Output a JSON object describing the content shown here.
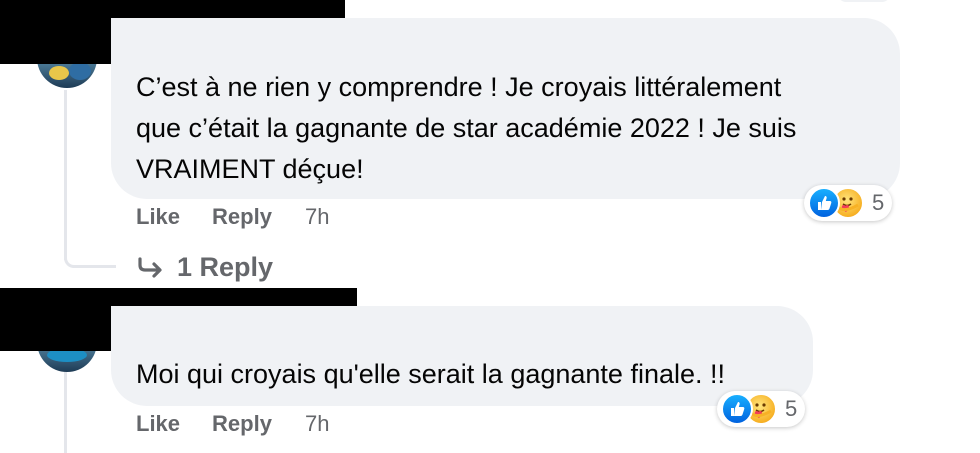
{
  "comments": [
    {
      "author_redacted": true,
      "text": "C’est à ne rien y comprendre ! Je croyais littéralement\nque c’était la gagnante de star académie 2022 ! Je suis\nVRAIMENT déçue!",
      "reactions": {
        "icons": [
          "like-reaction-icon",
          "care-reaction-icon"
        ],
        "count": "5"
      },
      "actions": {
        "like": "Like",
        "reply": "Reply",
        "time": "7h"
      },
      "replies_link": "1 Reply"
    },
    {
      "author_redacted": true,
      "text": "Moi qui croyais qu'elle serait la gagnante finale. !!",
      "reactions": {
        "icons": [
          "like-reaction-icon",
          "care-reaction-icon"
        ],
        "count": "5"
      },
      "actions": {
        "like": "Like",
        "reply": "Reply",
        "time": "7h"
      }
    }
  ],
  "colors": {
    "bubble_bg": "#f0f2f5",
    "secondary_text": "#65676b",
    "primary_text": "#050505",
    "like_blue": "#0866ff",
    "thread_line": "#e4e6eb"
  }
}
